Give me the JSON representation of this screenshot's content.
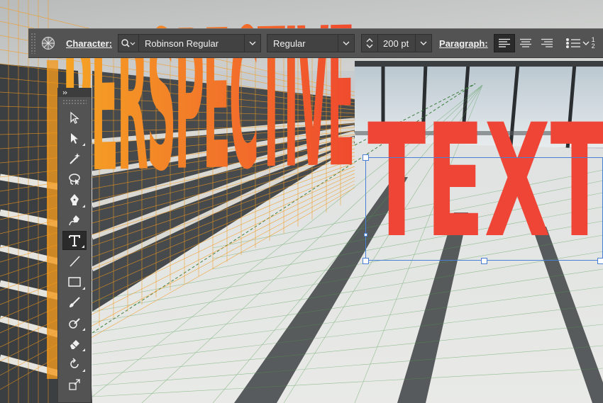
{
  "control_bar": {
    "character_label": "Character:",
    "font_family": "Robinson Regular",
    "font_style": "Regular",
    "font_size": "200 pt",
    "paragraph_label": "Paragraph:",
    "numbered_list_glyph": "1 2"
  },
  "tools": [
    {
      "name": "selection-tool",
      "icon": "arrow-outline-icon"
    },
    {
      "name": "direct-selection-tool",
      "icon": "arrow-filled-icon"
    },
    {
      "name": "magic-wand-tool",
      "icon": "magic-wand-icon"
    },
    {
      "name": "lasso-tool",
      "icon": "lasso-icon"
    },
    {
      "name": "pen-tool",
      "icon": "pen-icon"
    },
    {
      "name": "curvature-tool",
      "icon": "curvature-pen-icon"
    },
    {
      "name": "type-tool",
      "icon": "type-icon",
      "active": true
    },
    {
      "name": "line-segment-tool",
      "icon": "line-icon"
    },
    {
      "name": "rectangle-tool",
      "icon": "rectangle-icon"
    },
    {
      "name": "paintbrush-tool",
      "icon": "paintbrush-icon"
    },
    {
      "name": "shaper-tool",
      "icon": "shaper-icon"
    },
    {
      "name": "eraser-tool",
      "icon": "eraser-icon"
    },
    {
      "name": "rotate-tool",
      "icon": "rotate-icon"
    },
    {
      "name": "scale-tool",
      "icon": "scale-icon"
    }
  ],
  "canvas": {
    "perspective_text": "PERSPECTIVE",
    "plain_text": "TEXT",
    "colors": {
      "perspective_gradient_start": "#f5a524",
      "perspective_gradient_end": "#f04a2e",
      "text_fill": "#ee4536",
      "selection": "#4a7fd6",
      "grid_orange": "#f39a1e",
      "grid_green": "#4e9a4e",
      "panel_bg": "#535353"
    }
  }
}
